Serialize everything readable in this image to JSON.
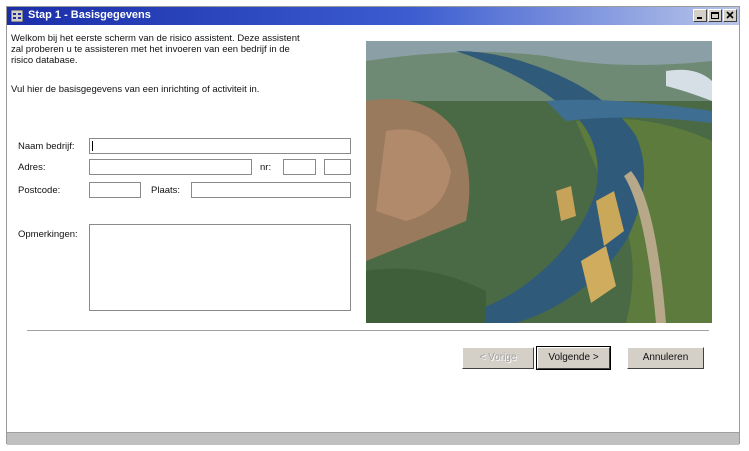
{
  "window": {
    "title": "Stap 1 - Basisgegevens"
  },
  "intro": {
    "line1": "Welkom bij het eerste scherm van de risico assistent. Deze assistent zal proberen u te assisteren met het invoeren van een bedrijf in de risico database.",
    "line2": "Vul hier de basisgegevens van een inrichting of activiteit in."
  },
  "form": {
    "naam_label": "Naam bedrijf:",
    "adres_label": "Adres:",
    "nr_label": "nr:",
    "postcode_label": "Postcode:",
    "plaats_label": "Plaats:",
    "opmerkingen_label": "Opmerkingen:",
    "naam_value": "",
    "adres_value": "",
    "nr_value": "",
    "toevoeging_value": "",
    "postcode_value": "",
    "plaats_value": "",
    "opmerkingen_value": ""
  },
  "buttons": {
    "vorige": "< Vorige",
    "volgende": "Volgende >",
    "annuleren": "Annuleren"
  },
  "colors": {
    "titlebar_start": "#1a2ea8",
    "titlebar_end": "#b9c6ea",
    "button_face": "#d4d0c8"
  }
}
